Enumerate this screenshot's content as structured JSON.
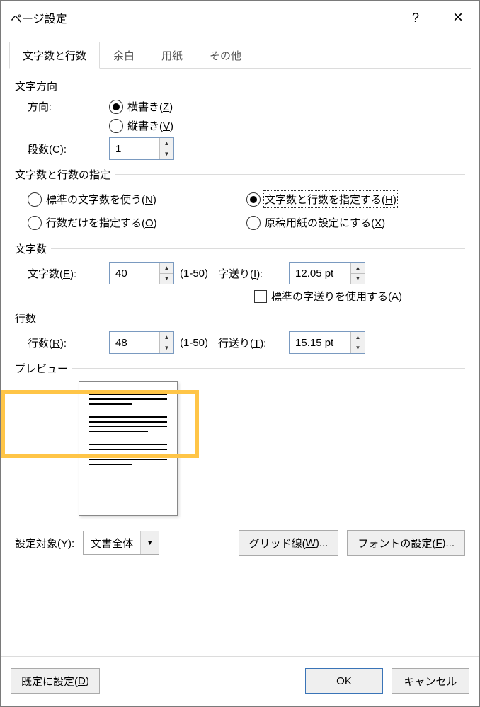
{
  "title": "ページ設定",
  "titlebar": {
    "help_icon": "?",
    "close_icon": "×"
  },
  "tabs": [
    "文字数と行数",
    "余白",
    "用紙",
    "その他"
  ],
  "active_tab": 0,
  "sec_direction": {
    "title": "文字方向",
    "orientation_label": "方向:",
    "horizontal_prefix": "横書き(",
    "horizontal_key": "Z",
    "horizontal_suffix": ")",
    "vertical_prefix": "縦書き(",
    "vertical_key": "V",
    "vertical_suffix": ")",
    "columns_prefix": "段数(",
    "columns_key": "C",
    "columns_suffix": "):",
    "columns_value": "1"
  },
  "sec_spec": {
    "title": "文字数と行数の指定",
    "opt_standard_prefix": "標準の文字数を使う(",
    "opt_standard_key": "N",
    "opt_standard_suffix": ")",
    "opt_both_prefix": "文字数と行数を指定する(",
    "opt_both_key": "H",
    "opt_both_suffix": ")",
    "opt_lines_prefix": "行数だけを指定する(",
    "opt_lines_key": "O",
    "opt_lines_suffix": ")",
    "opt_grid_prefix": "原稿用紙の設定にする(",
    "opt_grid_key": "X",
    "opt_grid_suffix": ")"
  },
  "sec_chars": {
    "title": "文字数",
    "chars_prefix": "文字数(",
    "chars_key": "E",
    "chars_suffix": "):",
    "chars_value": "40",
    "chars_range": "(1-50)",
    "pitch_prefix": "字送り(",
    "pitch_key": "I",
    "pitch_suffix": "):",
    "pitch_value": "12.05 pt",
    "std_pitch_prefix": "標準の字送りを使用する(",
    "std_pitch_key": "A",
    "std_pitch_suffix": ")"
  },
  "sec_lines": {
    "title": "行数",
    "lines_prefix": "行数(",
    "lines_key": "R",
    "lines_suffix": "):",
    "lines_value": "48",
    "lines_range": "(1-50)",
    "pitch_prefix": "行送り(",
    "pitch_key": "T",
    "pitch_suffix": "):",
    "pitch_value": "15.15 pt"
  },
  "sec_preview": {
    "title": "プレビュー"
  },
  "apply": {
    "label_prefix": "設定対象(",
    "label_key": "Y",
    "label_suffix": "):",
    "value": "文書全体",
    "grid_btn_prefix": "グリッド線(",
    "grid_btn_key": "W",
    "grid_btn_suffix": ")...",
    "font_btn_prefix": "フォントの設定(",
    "font_btn_key": "F",
    "font_btn_suffix": ")..."
  },
  "footer": {
    "default_prefix": "既定に設定(",
    "default_key": "D",
    "default_suffix": ")",
    "ok": "OK",
    "cancel": "キャンセル"
  }
}
